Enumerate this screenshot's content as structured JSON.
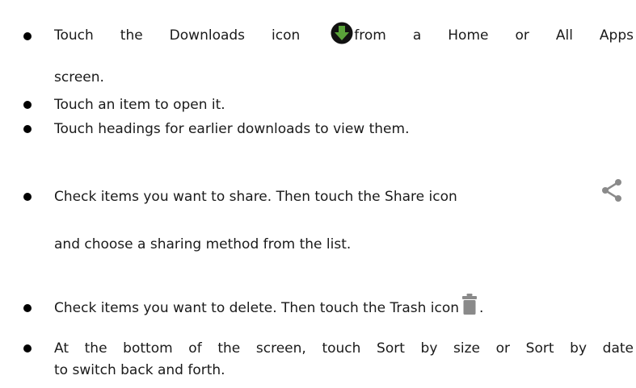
{
  "items": [
    {
      "before_icon": "Touch the Downloads icon",
      "after_icon": "from a Home or All Apps",
      "continuation": "screen.",
      "icon": "download-icon",
      "icon_color": "#5aa33a"
    },
    {
      "text": "Touch an item to open it."
    },
    {
      "text": "Touch headings for earlier downloads to view them."
    },
    {
      "text": "Check items you want to share. Then touch the Share icon",
      "continuation": "and choose a sharing method from the list.",
      "icon": "share-icon",
      "icon_color": "#8a8a8a"
    },
    {
      "text": "Check items you want to delete. Then touch the Trash icon",
      "after_icon": ".",
      "icon": "trash-icon",
      "icon_color": "#8a8a8a"
    },
    {
      "text": "At the bottom of the screen, touch Sort by size or Sort by date",
      "continuation": "to switch back and forth."
    }
  ]
}
